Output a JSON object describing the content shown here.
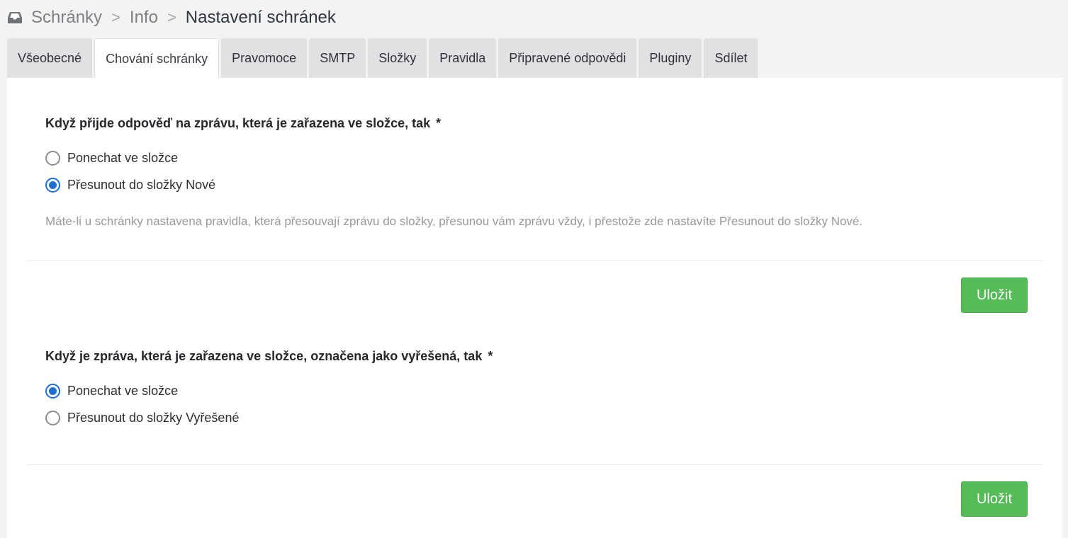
{
  "breadcrumb": {
    "icon": "inbox-icon",
    "items": [
      "Schránky",
      "Info"
    ],
    "separator": ">",
    "current": "Nastavení schránek"
  },
  "tabs": [
    {
      "label": "Všeobecné",
      "active": false
    },
    {
      "label": "Chování schránky",
      "active": true
    },
    {
      "label": "Pravomoce",
      "active": false
    },
    {
      "label": "SMTP",
      "active": false
    },
    {
      "label": "Složky",
      "active": false
    },
    {
      "label": "Pravidla",
      "active": false
    },
    {
      "label": "Připravené odpovědi",
      "active": false
    },
    {
      "label": "Pluginy",
      "active": false
    },
    {
      "label": "Sdílet",
      "active": false
    }
  ],
  "section1": {
    "title": "Když přijde odpověď na zprávu, která je zařazena ve složce, tak",
    "required": "*",
    "options": [
      {
        "label": "Ponechat ve složce",
        "checked": false
      },
      {
        "label": "Přesunout do složky Nové",
        "checked": true
      }
    ],
    "hint": "Máte-li u schránky nastavena pravidla, která přesouvají zprávu do složky, přesunou vám zprávu vždy, i přestože zde nastavíte Přesunout do složky Nové.",
    "save_label": "Uložit"
  },
  "section2": {
    "title": "Když je zpráva, která je zařazena ve složce, označena jako vyřešená, tak",
    "required": "*",
    "options": [
      {
        "label": "Ponechat ve složce",
        "checked": true
      },
      {
        "label": "Přesunout do složky Vyřešené",
        "checked": false
      }
    ],
    "save_label": "Uložit"
  },
  "colors": {
    "accent": "#1f6fd1",
    "save_button": "#55bb58",
    "background": "#f3f3f4",
    "tab_inactive": "#e1e1e3"
  }
}
